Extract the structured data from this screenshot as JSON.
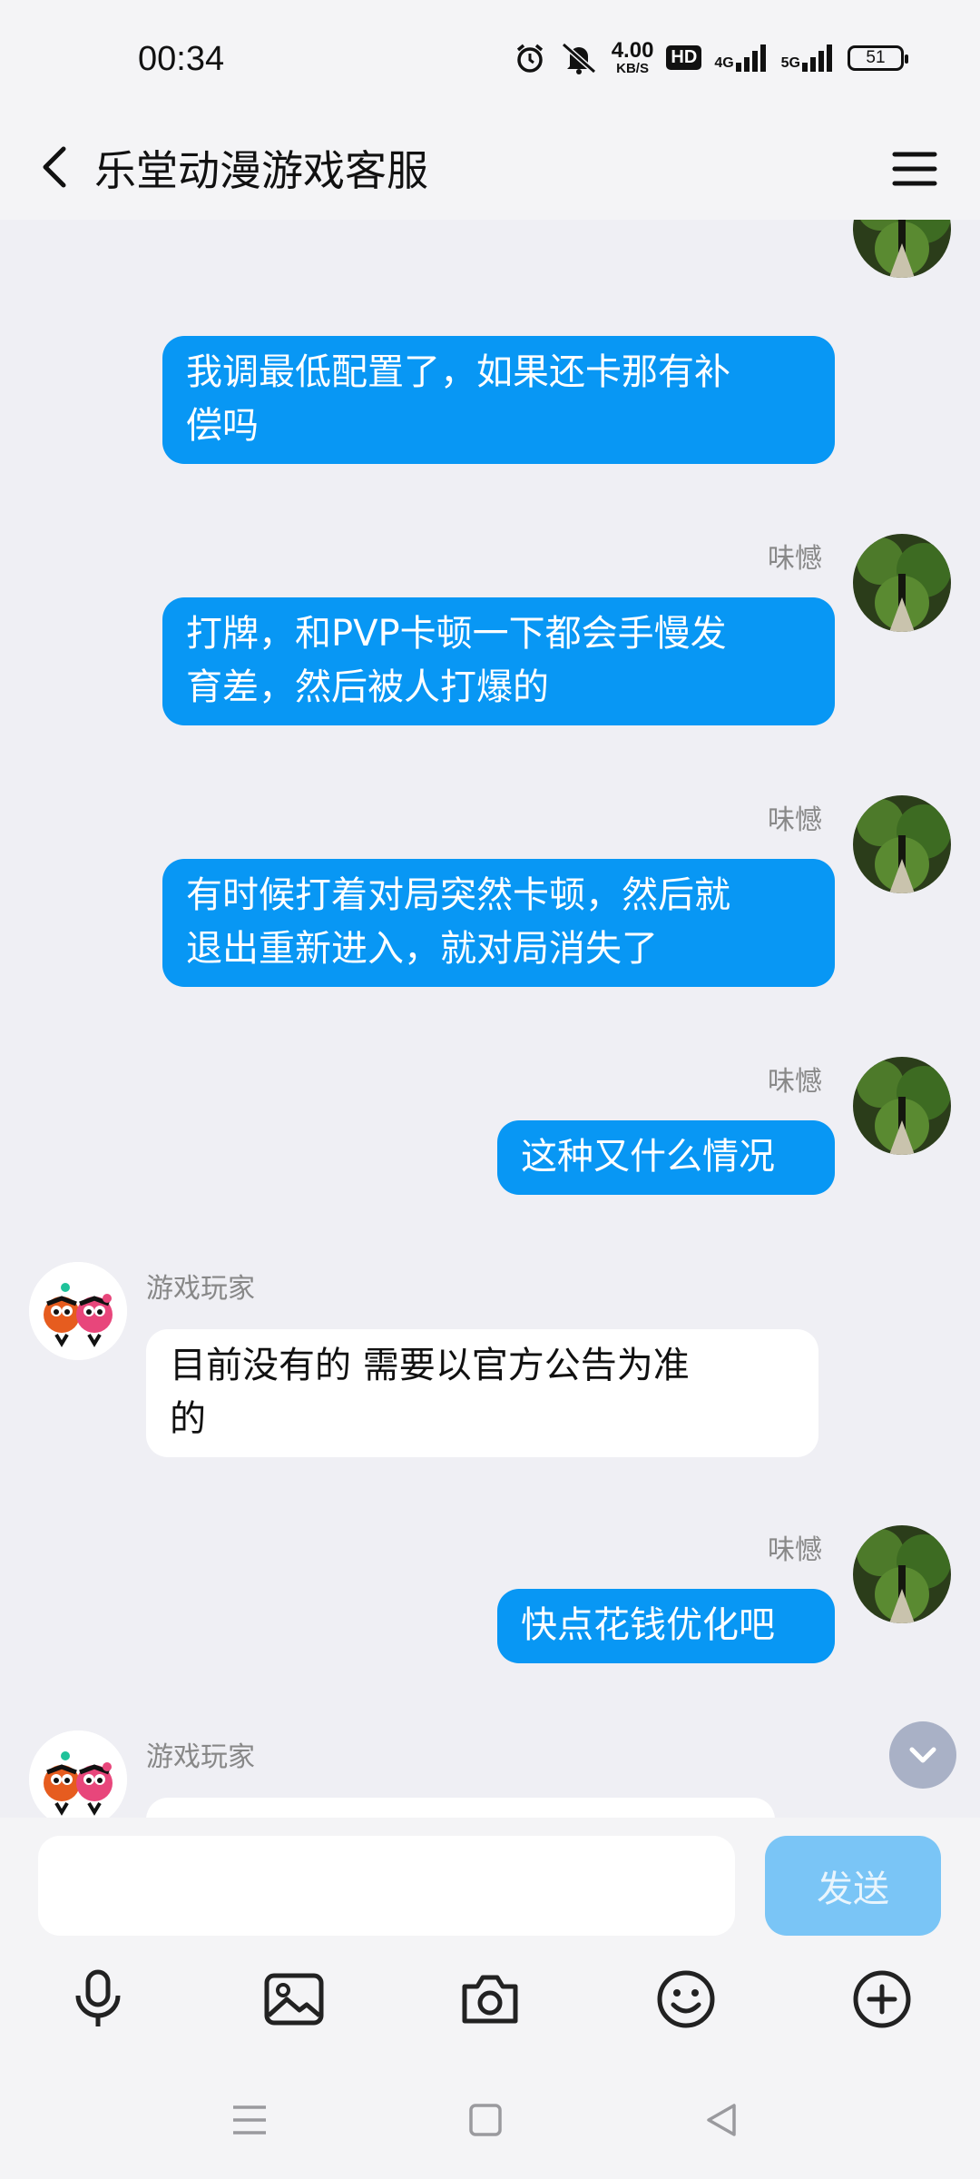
{
  "status_bar": {
    "time": "00:34",
    "net_speed_value": "4.00",
    "net_speed_unit": "KB/S",
    "hd_label": "HD",
    "sim1_label": "4G",
    "sim2_label": "5G",
    "battery_level": "51"
  },
  "header": {
    "title": "乐堂动漫游戏客服",
    "back_icon": "chevron-left-icon",
    "menu_icon": "hamburger-menu-icon"
  },
  "messages": [
    {
      "sender": "me",
      "name": "",
      "text_lines": [
        "我调最低配置了，如果还卡那有补",
        "偿吗"
      ]
    },
    {
      "sender": "me",
      "name": "味憾",
      "text_lines": [
        "打牌，和PVP卡顿一下都会手慢发",
        "育差，然后被人打爆的"
      ]
    },
    {
      "sender": "me",
      "name": "味憾",
      "text_lines": [
        "有时候打着对局突然卡顿，然后就",
        "退出重新进入，就对局消失了"
      ]
    },
    {
      "sender": "me",
      "name": "味憾",
      "text_lines": [
        "这种又什么情况"
      ]
    },
    {
      "sender": "them",
      "name": "游戏玩家",
      "text_lines": [
        "目前没有的 需要以官方公告为准",
        "的"
      ]
    },
    {
      "sender": "me",
      "name": "味憾",
      "text_lines": [
        "快点花钱优化吧"
      ]
    },
    {
      "sender": "them",
      "name": "游戏玩家",
      "text_lines": []
    }
  ],
  "input": {
    "placeholder": "",
    "send_label": "发送"
  },
  "toolbar": [
    "microphone-icon",
    "image-icon",
    "camera-icon",
    "emoji-icon",
    "plus-icon"
  ],
  "nav_bar": [
    "menu-icon",
    "home-square-icon",
    "back-triangle-icon"
  ],
  "colors": {
    "outgoing_bubble": "#0897f4",
    "incoming_bubble": "#ffffff",
    "background": "#efeff4",
    "send_button": "#7ac5f6"
  }
}
